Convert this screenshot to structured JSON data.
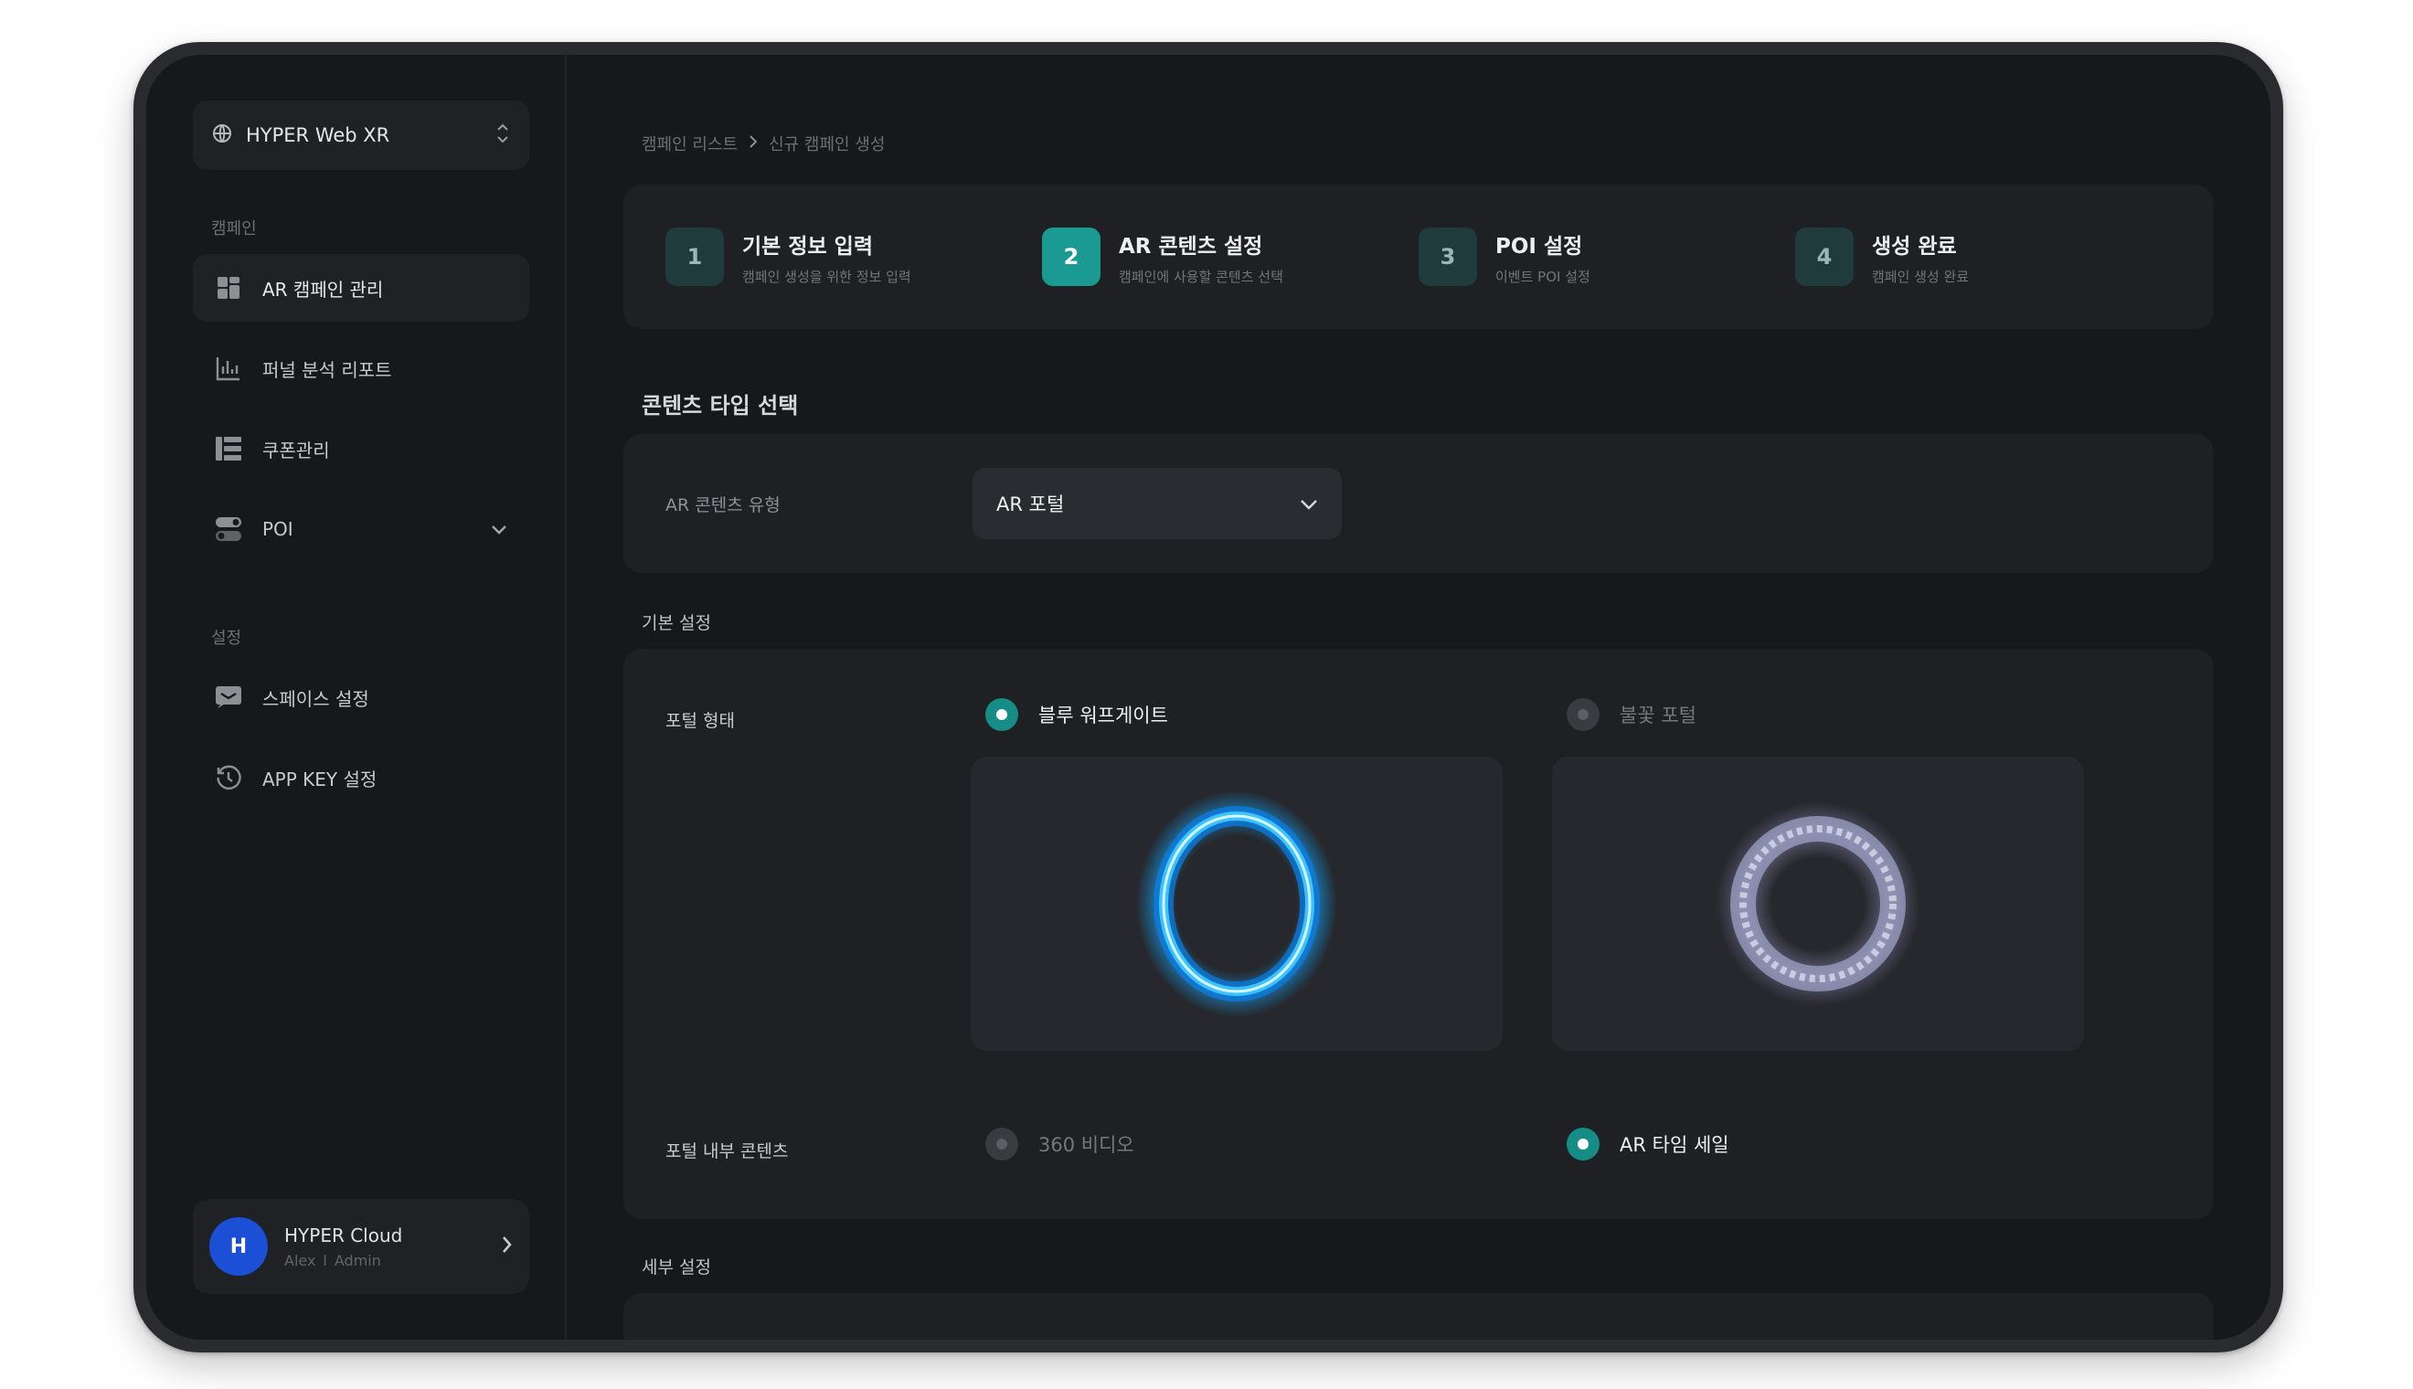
{
  "sidebar": {
    "workspace": {
      "label": "HYPER Web XR"
    },
    "sections": [
      {
        "label": "캠페인",
        "items": [
          {
            "label": "AR 캠페인 관리",
            "active": true
          },
          {
            "label": "퍼널 분석 리포트"
          },
          {
            "label": "쿠폰관리"
          },
          {
            "label": "POI"
          }
        ]
      },
      {
        "label": "설정",
        "items": [
          {
            "label": "스페이스 설정"
          },
          {
            "label": "APP KEY 설정"
          }
        ]
      }
    ],
    "profile": {
      "initial": "H",
      "name": "HYPER Cloud",
      "user": "Alex",
      "separator": "l",
      "role": "Admin"
    }
  },
  "breadcrumb": {
    "parent": "캠페인 리스트",
    "current": "신규 캠페인 생성"
  },
  "stepper": {
    "steps": [
      {
        "num": "1",
        "title": "기본 정보 입력",
        "desc": "캠페인 생성을 위한 정보 입력"
      },
      {
        "num": "2",
        "title": "AR 콘텐츠 설정",
        "desc": "캠페인에 사용할 콘텐츠 선택",
        "active": true
      },
      {
        "num": "3",
        "title": "POI 설정",
        "desc": "이벤트 POI 설정"
      },
      {
        "num": "4",
        "title": "생성 완료",
        "desc": "캠페인 생성 완료"
      }
    ]
  },
  "content_type": {
    "title": "콘텐츠 타입 선택",
    "field_label": "AR 콘텐츠 유형",
    "selected": "AR 포털"
  },
  "basic": {
    "title": "기본 설정",
    "portal_shape": {
      "label": "포털 형태",
      "options": [
        {
          "label": "블루 워프게이트",
          "selected": true
        },
        {
          "label": "불꽃 포털",
          "selected": false
        }
      ]
    },
    "portal_inner": {
      "label": "포털 내부 콘텐츠",
      "options": [
        {
          "label": "360 비디오",
          "selected": false
        },
        {
          "label": "AR 타임 세일",
          "selected": true
        }
      ]
    }
  },
  "detail": {
    "title": "세부 설정"
  },
  "colors": {
    "accent": "#1a9a92",
    "avatar": "#1b4fd6",
    "background": "#17181b",
    "card": "#1f2024"
  }
}
